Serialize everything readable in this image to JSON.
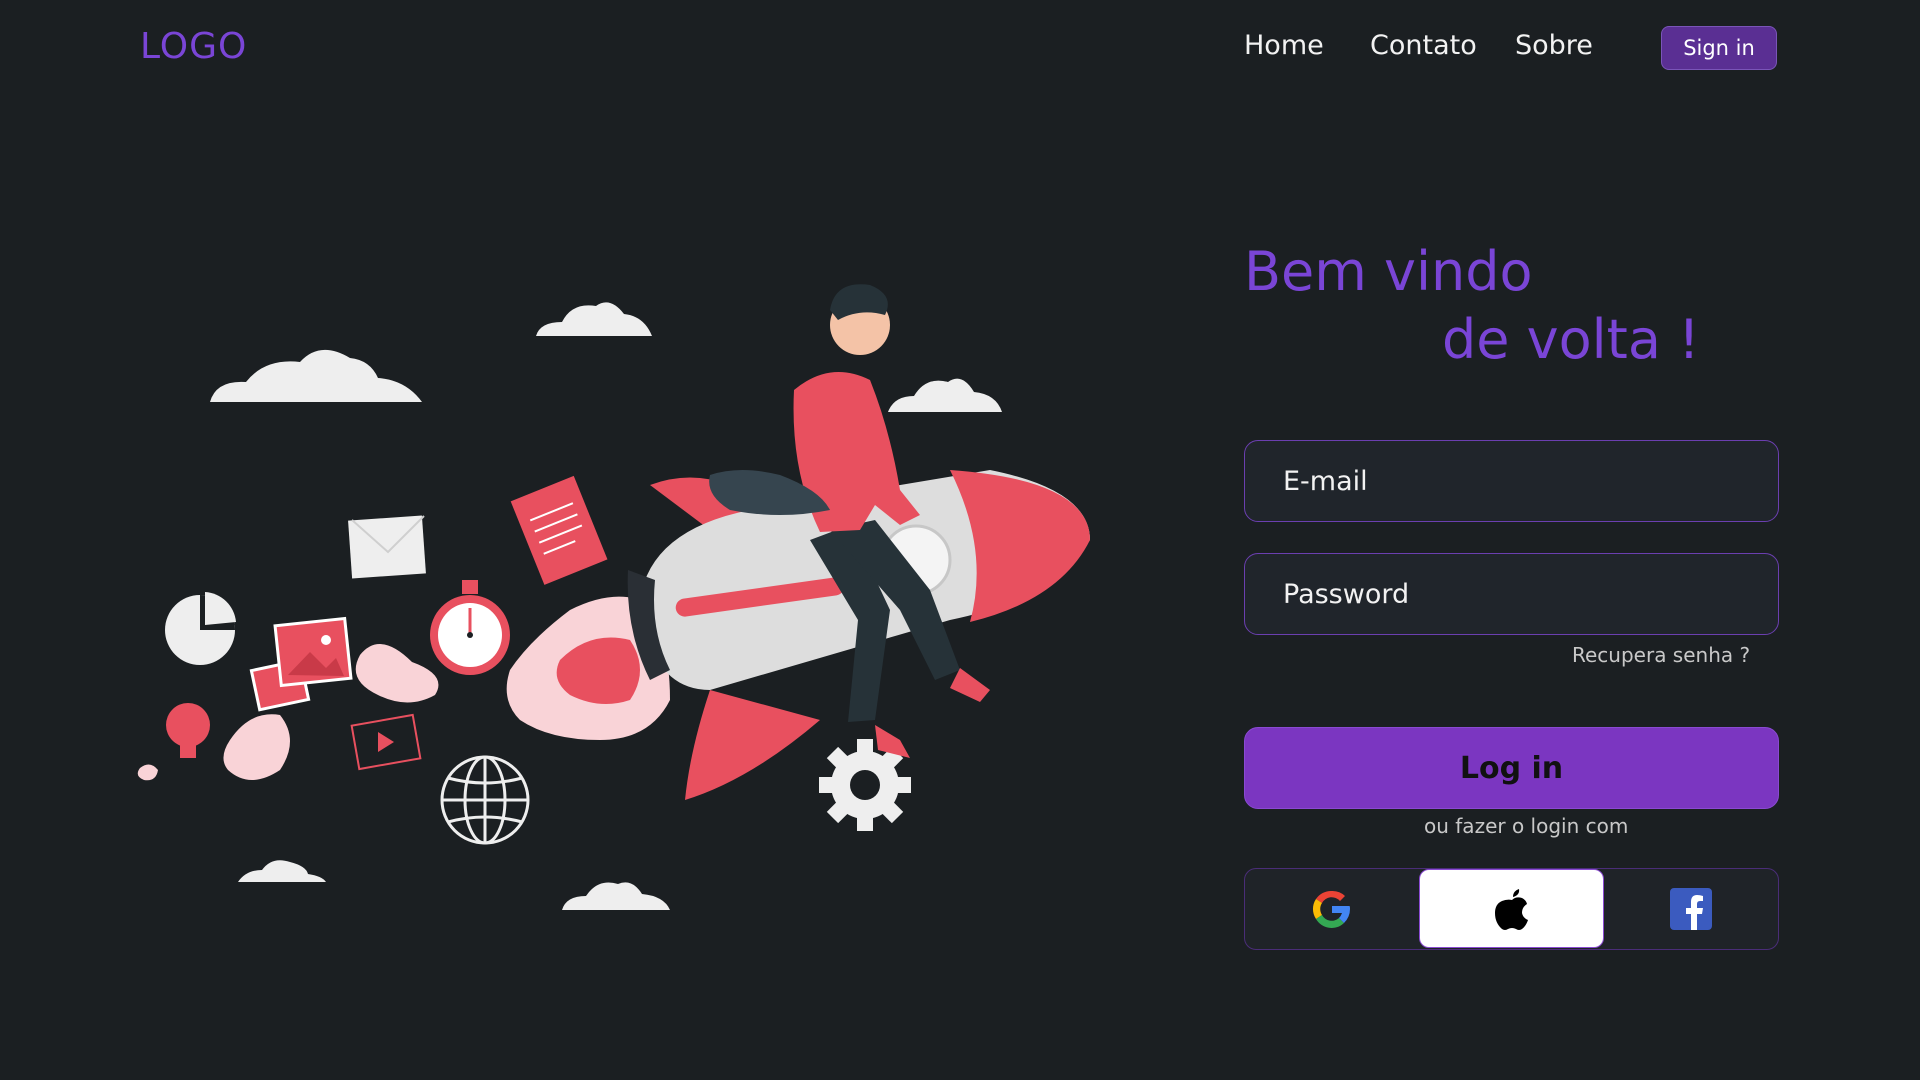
{
  "header": {
    "logo": "LOGO",
    "nav": [
      {
        "label": "Home"
      },
      {
        "label": "Contato"
      },
      {
        "label": "Sobre"
      }
    ],
    "signin_label": "Sign in"
  },
  "welcome": {
    "line1": "Bem vindo",
    "line2": "de volta !"
  },
  "form": {
    "email_placeholder": "E-mail",
    "password_placeholder": "Password",
    "recover_label": "Recupera senha ?",
    "login_label": "Log in",
    "or_text": "ou fazer o login com"
  },
  "social": [
    {
      "icon": "google-icon"
    },
    {
      "icon": "apple-icon"
    },
    {
      "icon": "facebook-icon"
    }
  ],
  "colors": {
    "background": "#1b1f22",
    "accent": "#7a45d6",
    "button": "#7b36c1",
    "illustration_red": "#e8505f"
  }
}
